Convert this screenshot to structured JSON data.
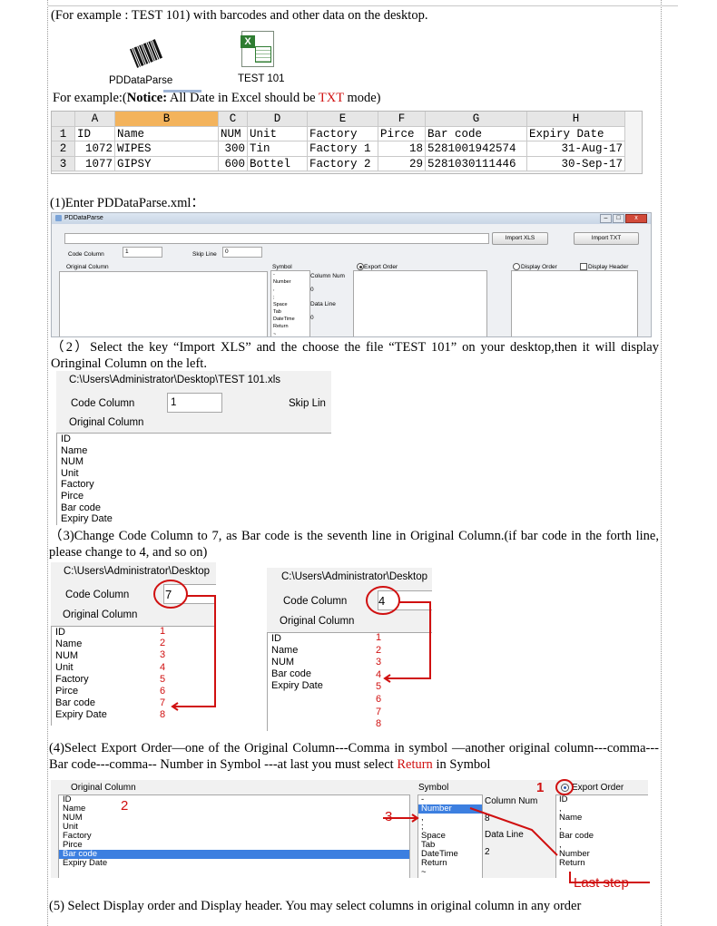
{
  "intro": "(For example : TEST 101) with barcodes and other data on the desktop.",
  "icons": {
    "app_label": "PDDataParse",
    "file_label": "TEST 101"
  },
  "example_note": {
    "pre": "For example:(",
    "bold": "Notice:",
    "mid": " All Date in Excel should be ",
    "txt": "TXT",
    "post": " mode)"
  },
  "spreadsheet": {
    "columns": [
      "A",
      "B",
      "C",
      "D",
      "E",
      "F",
      "G",
      "H"
    ],
    "row_numbers": [
      "1",
      "2",
      "3"
    ],
    "rows": [
      [
        "ID",
        "Name",
        "NUM",
        "Unit",
        "Factory",
        "Pirce",
        "Bar code",
        "Expiry Date"
      ],
      [
        "1072",
        "WIPES",
        "300",
        "Tin",
        "Factory 1",
        "18",
        "5281001942574",
        "31-Aug-17"
      ],
      [
        "1077",
        "GIPSY",
        "600",
        "Bottel",
        "Factory 2",
        "29",
        "5281030111446",
        "30-Sep-17"
      ]
    ]
  },
  "step1": "(1)Enter PDDataParse.xml：",
  "app": {
    "title": "PDDataParse",
    "import_xls": "Import XLS",
    "import_txt": "Import TXT",
    "code_column_label": "Code Column",
    "code_column_value": "1",
    "skip_line_label": "Skip Line",
    "skip_line_value": "0",
    "original_column_label": "Original Column",
    "symbol_label": "Symbol",
    "symbols": [
      "-",
      "Number",
      ",",
      ";",
      "Space",
      "Tab",
      "DateTime",
      "Return",
      "~"
    ],
    "column_num_label": "Column Num",
    "column_num_value": "0",
    "data_line_label": "Data Line",
    "data_line_value": "0",
    "export_order_label": "Export Order",
    "display_order_label": "Display Order",
    "display_header_label": "Display Header"
  },
  "step2": "（2）Select the key “Import XLS” and the choose the file “TEST 101” on your desktop,then it will display Oringinal Column on the left.",
  "shot2": {
    "path": "C:\\Users\\Administrator\\Desktop\\TEST 101.xls",
    "code_column_label": "Code Column",
    "code_column_value": "1",
    "skip_line_label": "Skip Lin",
    "original_column_label": "Original Column",
    "items": [
      "ID",
      "Name",
      "NUM",
      "Unit",
      "Factory",
      "Pirce",
      "Bar code",
      "Expiry Date"
    ]
  },
  "step3": "（3)Change Code Column to 7, as Bar code is the seventh line in Original Column.(if bar code in the forth line, please change to 4, and so on)",
  "shot3a": {
    "path": "C:\\Users\\Administrator\\Desktop",
    "code_column_label": "Code Column",
    "code_value": "7",
    "original_column_label": "Original Column",
    "items": [
      "ID",
      "Name",
      "NUM",
      "Unit",
      "Factory",
      "Pirce",
      "Bar code",
      "Expiry Date"
    ],
    "numbers": [
      "1",
      "2",
      "3",
      "4",
      "5",
      "6",
      "7",
      "8"
    ]
  },
  "shot3b": {
    "path": "C:\\Users\\Administrator\\Desktop",
    "code_column_label": "Code Column",
    "code_value": "4",
    "original_column_label": "Original Column",
    "items": [
      "ID",
      "Name",
      "NUM",
      "Bar code",
      "Expiry Date"
    ],
    "numbers": [
      "1",
      "2",
      "3",
      "4",
      "5",
      "6",
      "7",
      "8"
    ]
  },
  "step4": {
    "pre": "(4)Select Export Order—one of the Original Column---Comma in symbol —another original column---comma---Bar code---comma-- Number in Symbol ---at last you must select ",
    "ret": "Return",
    "post": " in Symbol"
  },
  "shot4": {
    "original_column_label": "Original Column",
    "items": [
      "ID",
      "Name",
      "NUM",
      "Unit",
      "Factory",
      "Pirce",
      "Bar code",
      "Expiry Date"
    ],
    "symbol_label": "Symbol",
    "symbols": [
      "-",
      "Number",
      ",",
      ";",
      "Space",
      "Tab",
      "DateTime",
      "Return",
      "~"
    ],
    "column_num_label": "Column Num",
    "column_num_value": "8",
    "data_line_label": "Data Line",
    "data_line_value": "2",
    "export_order_label": "Export Order",
    "export_items": [
      "ID",
      ",",
      "Name",
      ",",
      "Bar code",
      ",",
      "Number",
      "Return"
    ],
    "mark1": "1",
    "mark2": "2",
    "mark3": "3",
    "last_step": "Last step"
  },
  "step5": "(5) Select Display order and Display header. You may select columns in original column in any order"
}
